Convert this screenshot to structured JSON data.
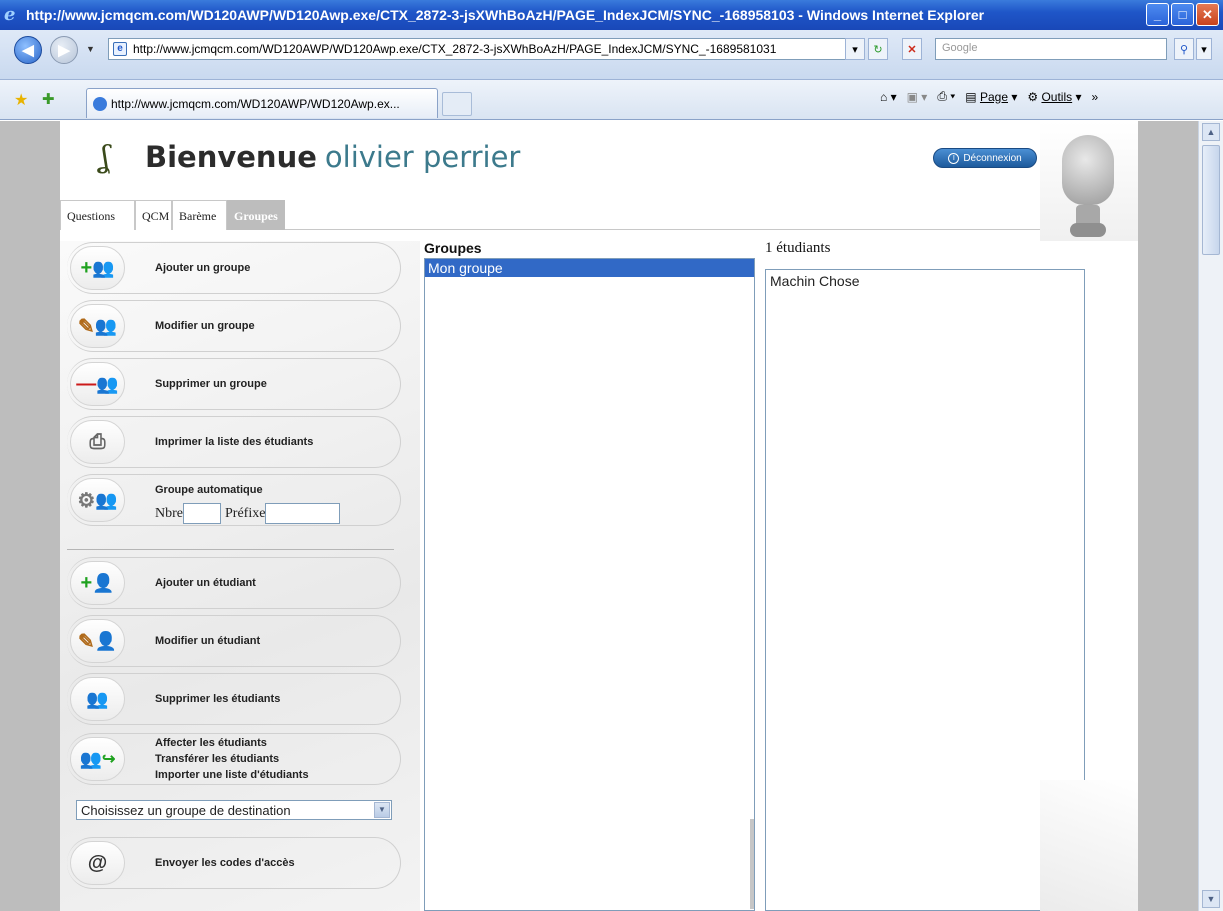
{
  "browser": {
    "title": "http://www.jcmqcm.com/WD120AWP/WD120Awp.exe/CTX_2872-3-jsXWhBoAzH/PAGE_IndexJCM/SYNC_-168958103 - Windows Internet Explorer",
    "url": "http://www.jcmqcm.com/WD120AWP/WD120Awp.exe/CTX_2872-3-jsXWhBoAzH/PAGE_IndexJCM/SYNC_-1689581031",
    "search_placeholder": "Google",
    "tab_label": "http://www.jcmqcm.com/WD120AWP/WD120Awp.ex...",
    "tools": {
      "page": "Page",
      "outils": "Outils"
    }
  },
  "header": {
    "welcome": "Bienvenue",
    "username": "olivier perrier",
    "logout": "Déconnexion"
  },
  "tabs": [
    {
      "label": "Questions"
    },
    {
      "label": "QCM"
    },
    {
      "label": "Barème"
    },
    {
      "label": "Groupes",
      "active": true
    }
  ],
  "actions": {
    "add_group": "Ajouter un groupe",
    "edit_group": "Modifier un groupe",
    "delete_group": "Supprimer un groupe",
    "print_list": "Imprimer la liste des étudiants",
    "auto_group": "Groupe automatique",
    "nbre_label": "Nbre",
    "prefix_label": "Préfixe",
    "add_student": "Ajouter un étudiant",
    "edit_student": "Modifier un étudiant",
    "delete_students": "Supprimer les étudiants",
    "assign_students": "Affecter les étudiants",
    "transfer_students": "Transférer les étudiants",
    "import_students": "Importer une liste d'étudiants",
    "dest_group": "Choisissez un groupe de destination",
    "send_codes": "Envoyer les codes d'accès"
  },
  "groups": {
    "title": "Groupes",
    "items": [
      "Mon groupe"
    ]
  },
  "students": {
    "title": "1 étudiants",
    "items": [
      "Machin Chose"
    ]
  },
  "colors": {
    "titlebar": "#1f56c8",
    "selection": "#3169c6",
    "username": "#3c7a8c"
  }
}
